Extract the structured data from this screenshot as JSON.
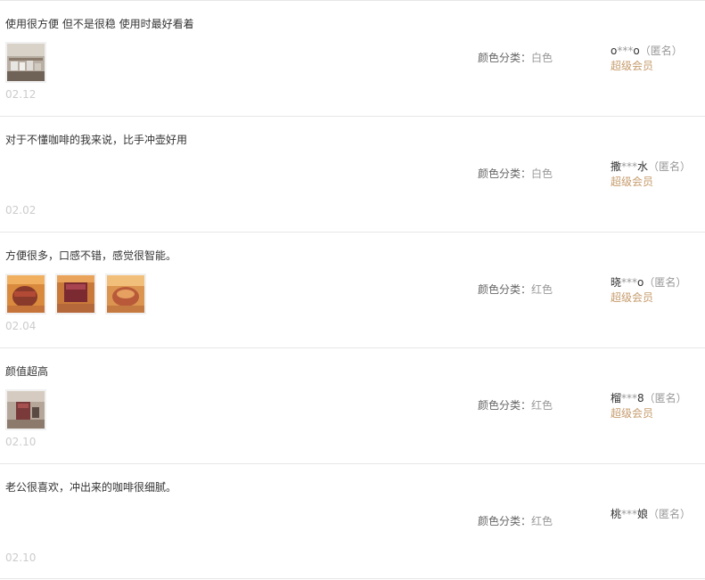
{
  "reviews": [
    {
      "text": "使用很方便 但不是很稳 使用时最好看着",
      "date": "02.12",
      "sku_label": "颜色分类：",
      "sku_value": "白色",
      "user_prefix": "o",
      "user_mask": "***",
      "user_suffix": "o",
      "anon": "（匿名）",
      "vip": "超级会员",
      "photos": [
        "review-photo-kitchen-shelf"
      ]
    },
    {
      "text": "对于不懂咖啡的我来说，比手冲壶好用",
      "date": "02.02",
      "sku_label": "颜色分类：",
      "sku_value": "白色",
      "user_prefix": "撒",
      "user_mask": "***",
      "user_suffix": "水",
      "anon": "（匿名）",
      "vip": "超级会员",
      "photos": []
    },
    {
      "text": "方便很多，口感不错，感觉很智能。",
      "date": "02.04",
      "sku_label": "颜色分类：",
      "sku_value": "红色",
      "user_prefix": "晓",
      "user_mask": "***",
      "user_suffix": "o",
      "anon": "（匿名）",
      "vip": "超级会员",
      "photos": [
        "review-photo-coffee-1",
        "review-photo-coffee-2",
        "review-photo-coffee-3"
      ]
    },
    {
      "text": "颜值超高",
      "date": "02.10",
      "sku_label": "颜色分类：",
      "sku_value": "红色",
      "user_prefix": "榴",
      "user_mask": "***",
      "user_suffix": "8",
      "anon": "（匿名）",
      "vip": "超级会员",
      "photos": [
        "review-photo-red-machine"
      ]
    },
    {
      "text": "老公很喜欢，冲出来的咖啡很细腻。",
      "date": "02.10",
      "sku_label": "颜色分类：",
      "sku_value": "红色",
      "user_prefix": "桃",
      "user_mask": "***",
      "user_suffix": "娘",
      "anon": "（匿名）",
      "vip": "",
      "photos": []
    }
  ],
  "colors": {
    "divider": "#e6e6e6",
    "text": "#333333",
    "muted": "#999999",
    "date": "#cccccc",
    "vip": "#c69c6d"
  }
}
